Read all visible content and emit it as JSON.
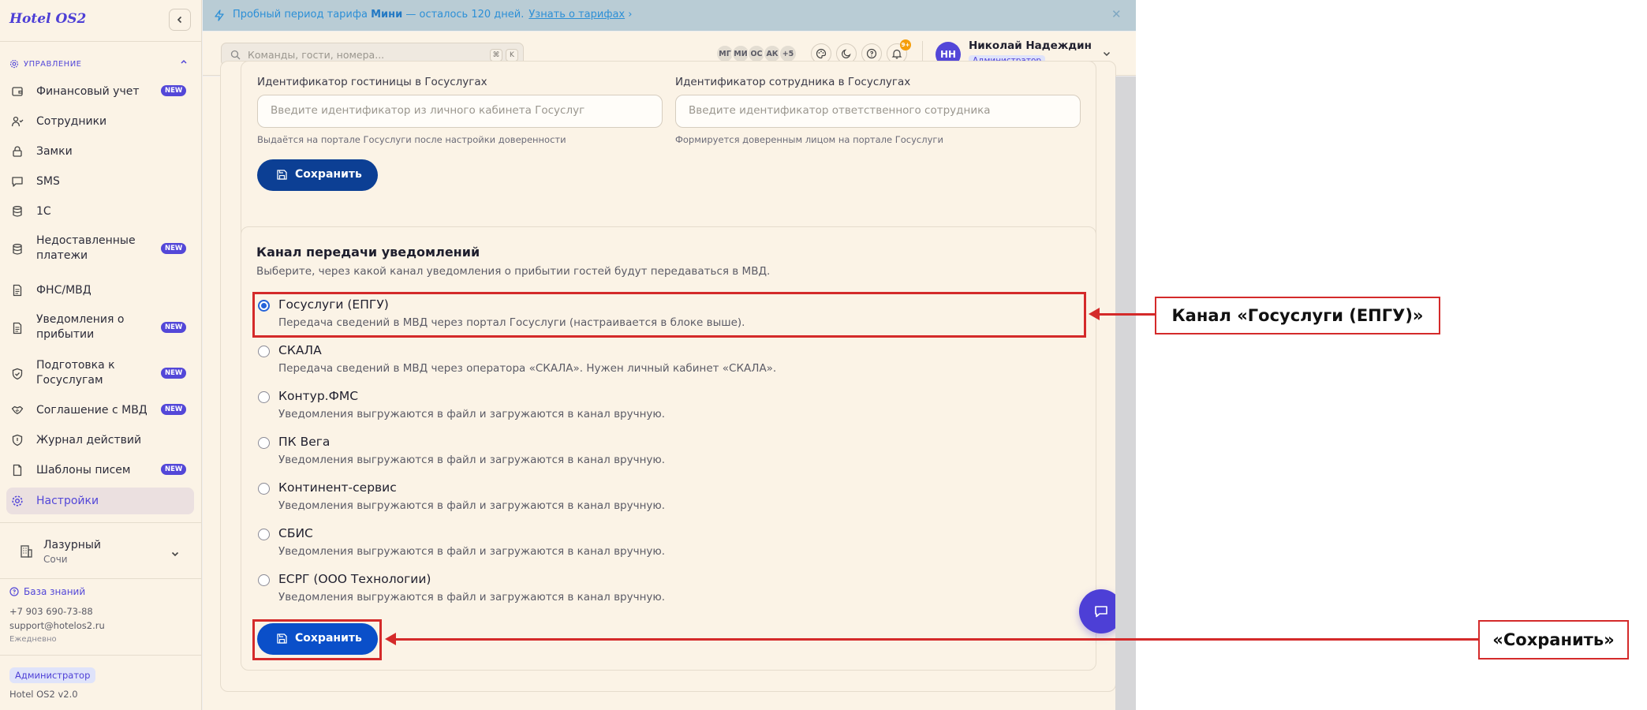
{
  "sidebar": {
    "logo": "Hotel OS2",
    "section": "УПРАВЛЕНИЕ",
    "items": [
      {
        "label": "Финансовый учет",
        "icon": "wallet-icon",
        "badge": "NEW"
      },
      {
        "label": "Сотрудники",
        "icon": "users-icon",
        "badge": ""
      },
      {
        "label": "Замки",
        "icon": "lock-icon",
        "badge": ""
      },
      {
        "label": "SMS",
        "icon": "message-icon",
        "badge": ""
      },
      {
        "label": "1С",
        "icon": "database-icon",
        "badge": ""
      },
      {
        "label": "Недоставленные платежи",
        "icon": "database-icon",
        "badge": "NEW"
      },
      {
        "label": "ФНС/МВД",
        "icon": "document-icon",
        "badge": ""
      },
      {
        "label": "Уведомления о прибытии",
        "icon": "document-icon",
        "badge": "NEW"
      },
      {
        "label": "Подготовка к Госуслугам",
        "icon": "shield-check-icon",
        "badge": "NEW"
      },
      {
        "label": "Соглашение с МВД",
        "icon": "handshake-icon",
        "badge": "NEW"
      },
      {
        "label": "Журнал действий",
        "icon": "shield-icon",
        "badge": ""
      },
      {
        "label": "Шаблоны писем",
        "icon": "file-icon",
        "badge": "NEW"
      },
      {
        "label": "Настройки",
        "icon": "gear-icon",
        "badge": ""
      }
    ],
    "hotel": {
      "name": "Лазурный",
      "city": "Сочи"
    },
    "knowledge_base": "База знаний",
    "phone": "+7 903 690-73-88",
    "email": "support@hotelos2.ru",
    "schedule": "Ежедневно",
    "role": "Администратор",
    "version": "Hotel OS2 v2.0"
  },
  "banner": {
    "prefix": "Пробный период тарифа",
    "plan": "Мини",
    "suffix": "— осталось 120 дней.",
    "link": "Узнать о тарифах"
  },
  "topbar": {
    "search_placeholder": "Команды, гости, номера...",
    "kbd1": "⌘",
    "kbd2": "K",
    "avatars": [
      "МГ",
      "МИ",
      "ОС",
      "АК",
      "+5"
    ],
    "notifications": "9+",
    "user": {
      "initials": "НН",
      "name": "Николай Надеждин",
      "role": "Администратор"
    }
  },
  "form": {
    "hotel_id_label": "Идентификатор гостиницы в Госуслугах",
    "hotel_id_placeholder": "Введите идентификатор из личного кабинета Госуслуг",
    "hotel_id_hint": "Выдаётся на портале Госуслуги после настройки доверенности",
    "employee_id_label": "Идентификатор сотрудника в Госуслугах",
    "employee_id_placeholder": "Введите идентификатор ответственного сотрудника",
    "employee_id_hint": "Формируется доверенным лицом на портале Госуслуги",
    "save_label": "Сохранить"
  },
  "channel": {
    "title": "Канал передачи уведомлений",
    "description": "Выберите, через какой канал уведомления о прибытии гостей будут передаваться в МВД.",
    "selected": 0,
    "options": [
      {
        "title": "Госуслуги (ЕПГУ)",
        "desc": "Передача сведений в МВД через портал Госуслуги (настраивается в блоке выше)."
      },
      {
        "title": "СКАЛА",
        "desc": "Передача сведений в МВД через оператора «СКАЛА». Нужен личный кабинет «СКАЛА»."
      },
      {
        "title": "Контур.ФМС",
        "desc": "Уведомления выгружаются в файл и загружаются в канал вручную."
      },
      {
        "title": "ПК Вега",
        "desc": "Уведомления выгружаются в файл и загружаются в канал вручную."
      },
      {
        "title": "Континент-сервис",
        "desc": "Уведомления выгружаются в файл и загружаются в канал вручную."
      },
      {
        "title": "СБИС",
        "desc": "Уведомления выгружаются в файл и загружаются в канал вручную."
      },
      {
        "title": "ЕСРГ (ООО Технологии)",
        "desc": "Уведомления выгружаются в файл и загружаются в канал вручную."
      }
    ],
    "save_label": "Сохранить"
  },
  "annotations": {
    "callout_channel": "Канал «Госуслуги (ЕПГУ)»",
    "callout_save": "«Сохранить»",
    "color": "#d42a2a"
  },
  "colors": {
    "accent": "#5347d8",
    "primary_button": "#0a4fc9",
    "dark_button": "#0c3f94"
  }
}
